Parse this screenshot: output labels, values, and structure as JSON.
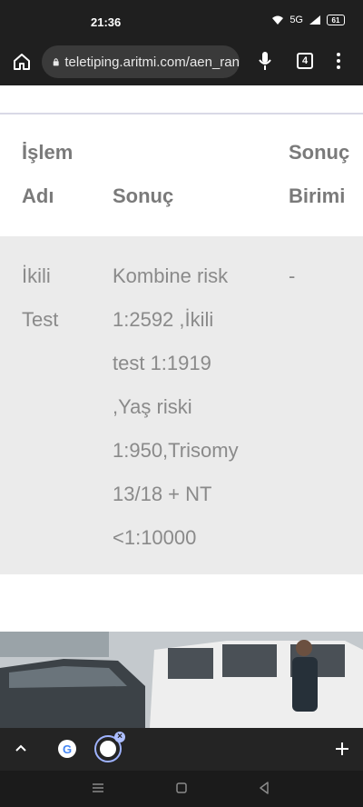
{
  "status_bar": {
    "time": "21:36",
    "network": "5G",
    "battery": "61"
  },
  "browser": {
    "url": "teletiping.aritmi.com/aen_ran",
    "tab_count": "4"
  },
  "table": {
    "headers": [
      {
        "lines": [
          "İşlem",
          "Adı"
        ]
      },
      {
        "lines": [
          "",
          "Sonuç"
        ]
      },
      {
        "lines": [
          "Sonuç",
          "Birimi"
        ]
      }
    ],
    "rows": [
      {
        "test_name": [
          "İkili",
          "Test"
        ],
        "result": [
          "Kombine risk",
          "1:2592 ,İkili",
          "test 1:1919",
          ",Yaş riski",
          "1:950,Trisomy",
          "13/18 + NT",
          "<1:10000"
        ],
        "unit": "-"
      }
    ]
  },
  "icons": {
    "home": "home-icon",
    "lock": "lock-icon",
    "mic": "microphone-icon",
    "menu": "more-vert-icon",
    "expand": "chevron-up-icon",
    "new_tab": "plus-icon"
  }
}
